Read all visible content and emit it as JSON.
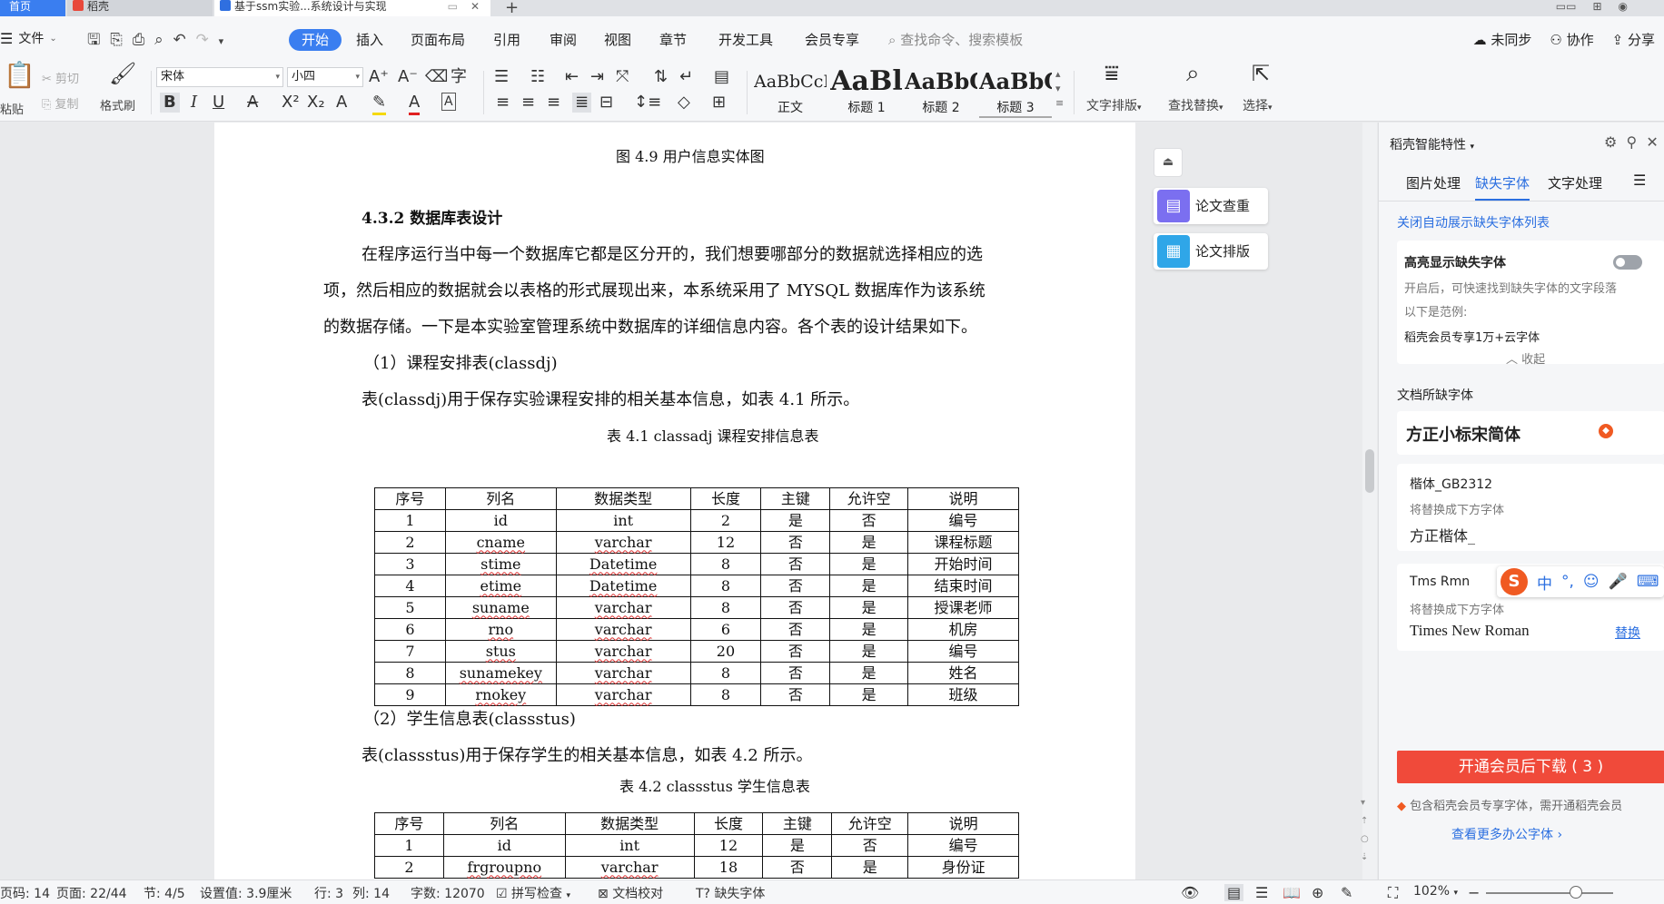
{
  "tabs": {
    "home": "首页",
    "daoke": "稻壳",
    "doc": "基于ssm实验...系统设计与实现"
  },
  "menu": {
    "file": "文件",
    "items": [
      "开始",
      "插入",
      "页面布局",
      "引用",
      "审阅",
      "视图",
      "章节",
      "开发工具",
      "会员专享"
    ],
    "search_placeholder": "查找命令、搜索模板",
    "unsync": "未同步",
    "collab": "协作",
    "share": "分享"
  },
  "ribbon": {
    "paste": "粘贴",
    "cut": "剪切",
    "copy": "复制",
    "format_painter": "格式刷",
    "font_name": "宋体",
    "font_size": "小四",
    "styles": [
      {
        "sample": "AaBbCcI",
        "label": "正文"
      },
      {
        "sample": "AaBl",
        "label": "标题 1"
      },
      {
        "sample": "AaBbC",
        "label": "标题 2"
      },
      {
        "sample": "AaBbC",
        "label": "标题 3"
      }
    ],
    "text_layout": "文字排版",
    "find_replace": "查找替换",
    "select": "选择"
  },
  "document": {
    "figure_caption": "图 4.9  用户信息实体图",
    "section_heading": "4.3.2  数据库表设计",
    "para1_line1": "在程序运行当中每一个数据库它都是区分开的，我们想要哪部分的数据就选择相应的选",
    "para1_line2": "项，然后相应的数据就会以表格的形式展现出来，本系统采用了 MYSQL 数据库作为该系统",
    "para1_line3": "的数据存储。一下是本实验室管理系统中数据库的详细信息内容。各个表的设计结果如下。",
    "item1_title": "（1）课程安排表(classdj)",
    "item1_desc": "表(classdj)用于保存实验课程安排的相关基本信息，如表 4.1 所示。",
    "table1_caption": "表 4.1 classadj 课程安排信息表",
    "table_headers": [
      "序号",
      "列名",
      "数据类型",
      "长度",
      "主键",
      "允许空",
      "说明"
    ],
    "table1_rows": [
      [
        "1",
        "id",
        "int",
        "2",
        "是",
        "否",
        "编号"
      ],
      [
        "2",
        "cname",
        "varchar",
        "12",
        "否",
        "是",
        "课程标题"
      ],
      [
        "3",
        "stime",
        "Datetime",
        "8",
        "否",
        "是",
        "开始时间"
      ],
      [
        "4",
        "etime",
        "Datetime",
        "8",
        "否",
        "是",
        "结束时间"
      ],
      [
        "5",
        "suname",
        "varchar",
        "8",
        "否",
        "是",
        "授课老师"
      ],
      [
        "6",
        "rno",
        "varchar",
        "6",
        "否",
        "是",
        "机房"
      ],
      [
        "7",
        "stus",
        "varchar",
        "20",
        "否",
        "是",
        "编号"
      ],
      [
        "8",
        "sunamekey",
        "varchar",
        "8",
        "否",
        "是",
        "姓名"
      ],
      [
        "9",
        "rnokey",
        "varchar",
        "8",
        "否",
        "是",
        "班级"
      ]
    ],
    "item2_title": "（2）学生信息表(classstus)",
    "item2_desc": "表(classstus)用于保存学生的相关基本信息，如表 4.2 所示。",
    "table2_caption": "表 4.2 classstus 学生信息表",
    "table2_rows": [
      [
        "1",
        "id",
        "int",
        "12",
        "是",
        "否",
        "编号"
      ],
      [
        "2",
        "frgroupno",
        "varchar",
        "18",
        "否",
        "是",
        "身份证"
      ]
    ]
  },
  "float_buttons": {
    "check": "论文查重",
    "layout": "论文排版"
  },
  "right_panel": {
    "title": "稻壳智能特性",
    "tabs": [
      "图片处理",
      "缺失字体",
      "文字处理"
    ],
    "close_auto_link": "关闭自动展示缺失字体列表",
    "highlight_title": "高亮显示缺失字体",
    "highlight_desc": "开启后，可快速找到缺失字体的文字段落",
    "example_label": "以下是范例:",
    "example_value": "稻壳会员专享1万+云字体",
    "collapse": "收起",
    "missing_title": "文档所缺字体",
    "missing_font1": "方正小标宋简体",
    "font2_name": "楷体_GB2312",
    "replace_hint": "将替换成下方字体",
    "font2_replacement": "方正楷体_",
    "font3_name": "Tms Rmn",
    "font3_replacement": "Times New Roman",
    "replace_link": "替换",
    "download_btn": "开通会员后下载 ( 3 )",
    "member_note": "包含稻壳会员专享字体，需开通稻壳会员",
    "more_link": "查看更多办公字体"
  },
  "ime": {
    "mode": "中"
  },
  "status": {
    "page_code": "页码: 14",
    "pages": "页面: 22/44",
    "section": "节: 4/5",
    "setting": "设置值: 3.9厘米",
    "row": "行: 3",
    "col": "列: 14",
    "words": "字数: 12070",
    "spell": "拼写检查",
    "proof": "文档校对",
    "missing_font": "缺失字体",
    "zoom": "102%"
  },
  "colors": {
    "accent": "#3a7ef0",
    "download": "#f04a3a",
    "link": "#2b6fe0"
  }
}
